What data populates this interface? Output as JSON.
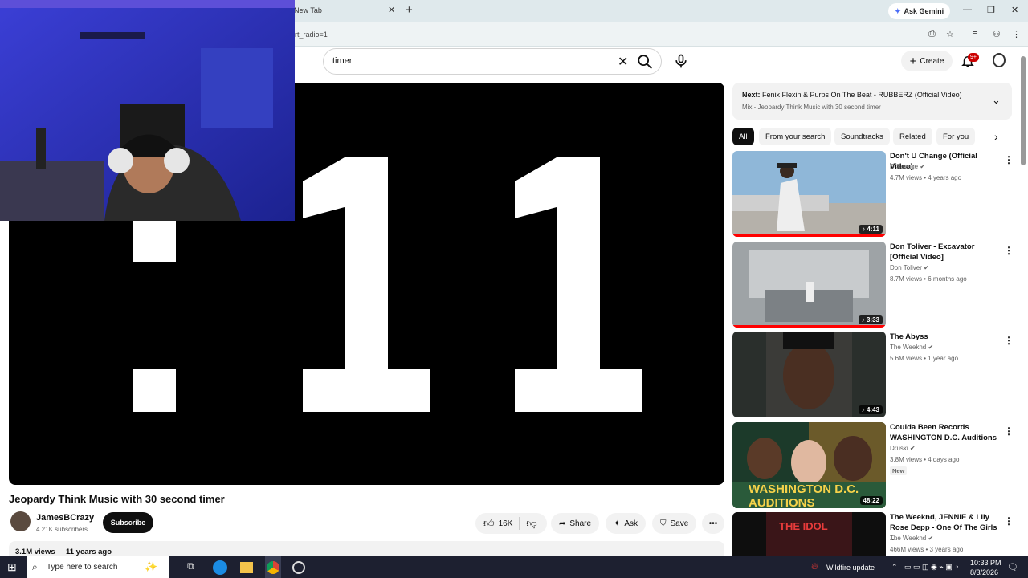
{
  "browser": {
    "tab_title": "New Tab",
    "gemini_label": "Ask Gemini",
    "url_fragment": "rt_radio=1"
  },
  "header": {
    "search_value": "timer",
    "create_label": "Create",
    "notification_count": "9+"
  },
  "player": {
    "display_digits": ":11"
  },
  "video": {
    "title": "Jeopardy Think Music with 30 second timer",
    "channel": "JamesBCrazy",
    "subscribers": "4.21K subscribers",
    "subscribe_label": "Subscribe",
    "likes": "16K",
    "share_label": "Share",
    "ask_label": "Ask",
    "save_label": "Save",
    "views": "3.1M views",
    "age": "11 years ago"
  },
  "up_next": {
    "label": "Next:",
    "title": "Fenix Flexin & Purps On The Beat - RUBBERZ (Official Video)",
    "mix": "Mix - Jeopardy Think Music with 30 second timer"
  },
  "chips": [
    "All",
    "From your search",
    "Soundtracks",
    "Related",
    "For you"
  ],
  "recommendations": [
    {
      "title": "Don't U Change (Official Video)",
      "channel": "D Savage",
      "meta": "4.7M views • 4 years ago",
      "duration": "4:11"
    },
    {
      "title": "Don Toliver - Excavator [Official Video]",
      "channel": "Don Toliver",
      "meta": "8.7M views • 6 months ago",
      "duration": "3:33"
    },
    {
      "title": "The Abyss",
      "channel": "The Weeknd",
      "meta": "5.6M views • 1 year ago",
      "duration": "4:43"
    },
    {
      "title": "Coulda Been Records WASHINGTON D.C. Auditions ...",
      "channel": "Druski",
      "meta": "3.8M views • 4 days ago",
      "duration": "48:22",
      "badge": "New",
      "thumb_text": "WASHINGTON D.C. AUDITIONS"
    },
    {
      "title": "The Weeknd, JENNIE & Lily Rose Depp - One Of The Girls ...",
      "channel": "The Weeknd",
      "meta": "466M views • 3 years ago",
      "thumb_text": "THE IDOL"
    }
  ],
  "taskbar": {
    "search_placeholder": "Type here to search",
    "weather": "Wildfire update",
    "time": "10:33 PM",
    "date": "8/3/2026"
  }
}
